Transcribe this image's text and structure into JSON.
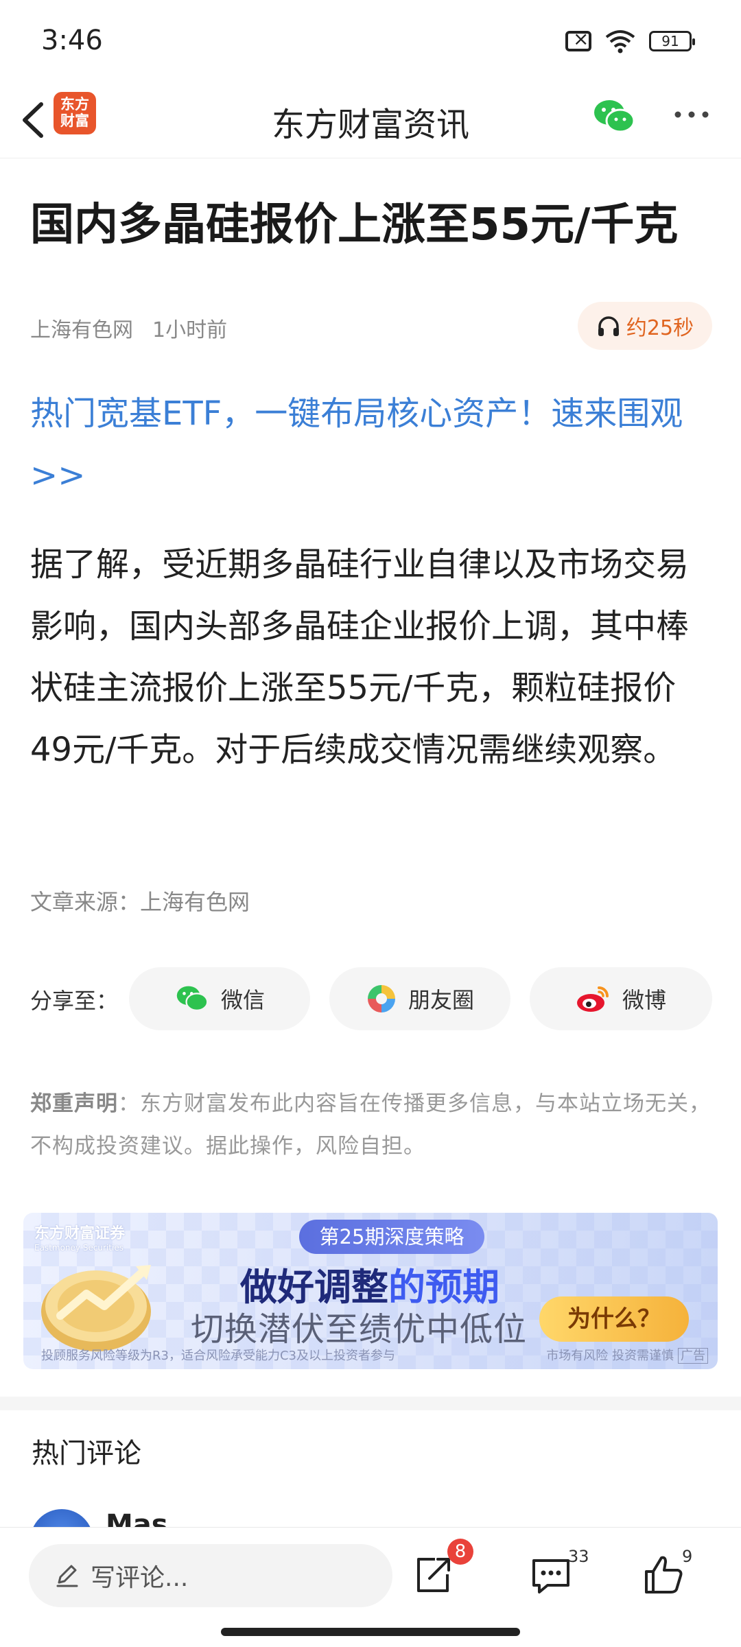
{
  "status_bar": {
    "time": "3:46",
    "battery": "91"
  },
  "nav": {
    "title": "东方财富资讯",
    "logo_text": "东方财富"
  },
  "article": {
    "title": "国内多晶硅报价上涨至55元/千克",
    "source_name": "上海有色网",
    "time_ago": "1小时前",
    "listen_label": "约25秒",
    "promo_link": "热门宽基ETF，一键布局核心资产！速来围观>>",
    "body": "据了解，受近期多晶硅行业自律以及市场交易影响，国内头部多晶硅企业报价上调，其中棒状硅主流报价上涨至55元/千克，颗粒硅报价49元/千克。对于后续成交情况需继续观察。",
    "source_line": "文章来源：上海有色网"
  },
  "share": {
    "label": "分享至：",
    "wechat": "微信",
    "moments": "朋友圈",
    "weibo": "微博"
  },
  "disclaimer": {
    "title": "郑重声明",
    "text": "：东方财富发布此内容旨在传播更多信息，与本站立场无关，不构成投资建议。据此操作，风险自担。"
  },
  "banner": {
    "brand": "东方财富证券",
    "brand_en": "Eastmoney Securities",
    "pill": "第25期深度策略",
    "headline_a": "做好调整",
    "headline_b": "的预期",
    "subline": "切换潜伏至绩优中低位",
    "cta": "为什么？",
    "risk_note": "投顾服务风险等级为R3，适合风险承受能力C3及以上投资者参与",
    "right_note": "市场有风险 投资需谨慎",
    "ad_tag": "广告"
  },
  "comments": {
    "section_title": "热门评论",
    "first_name": "Mas",
    "more": "···"
  },
  "bottom_bar": {
    "input_placeholder": "写评论...",
    "share_badge": "8",
    "comment_count": "33",
    "like_count": "9"
  },
  "colors": {
    "accent_blue": "#3b7fd6",
    "brand_orange": "#e8552b",
    "badge_red": "#e9423a"
  }
}
